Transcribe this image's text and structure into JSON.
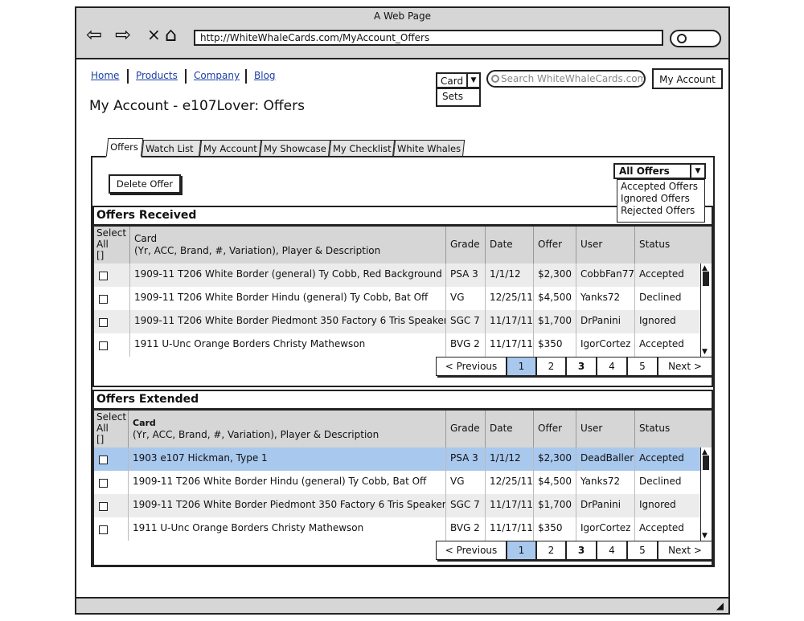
{
  "window": {
    "title": "A Web Page",
    "url": "http://WhiteWhaleCards.com/MyAccount_Offers"
  },
  "nav": {
    "home": "Home",
    "products": "Products",
    "company": "Company",
    "blog": "Blog"
  },
  "search": {
    "category": "Card",
    "option_sets": "Sets",
    "placeholder": "Search WhiteWhaleCards.com",
    "my_account": "My Account"
  },
  "page": {
    "title": "My Account - e107Lover: Offers"
  },
  "tabs": [
    {
      "label": "Offers"
    },
    {
      "label": "Watch List"
    },
    {
      "label": "My Account"
    },
    {
      "label": "My Showcase"
    },
    {
      "label": "My Checklist"
    },
    {
      "label": "White Whales"
    }
  ],
  "actions": {
    "delete_offer": "Delete Offer"
  },
  "filter": {
    "selected": "All Offers",
    "options": [
      "Accepted Offers",
      "Ignored Offers",
      "Rejected Offers"
    ]
  },
  "columns": {
    "select": [
      "Select",
      "All",
      "[]"
    ],
    "card": "Card",
    "card_sub": "(Yr, ACC, Brand, #, Variation), Player & Description",
    "grade": "Grade",
    "date": "Date",
    "offer": "Offer",
    "user": "User",
    "status": "Status"
  },
  "offers_received": {
    "title": "Offers Received",
    "rows": [
      {
        "card": "1909-11 T206 White Border (general) Ty Cobb, Red Background",
        "grade": "PSA 3",
        "date": "1/1/12",
        "offer": "$2,300",
        "user": "CobbFan77",
        "status": "Accepted"
      },
      {
        "card": "1909-11 T206 White Border Hindu (general) Ty Cobb, Bat Off",
        "grade": "VG",
        "date": "12/25/11",
        "offer": "$4,500",
        "user": "Yanks72",
        "status": "Declined"
      },
      {
        "card": "1909-11 T206 White Border Piedmont 350 Factory 6 Tris Speaker",
        "grade": "SGC 7",
        "date": "11/17/11",
        "offer": "$1,700",
        "user": "DrPanini",
        "status": "Ignored"
      },
      {
        "card": "1911 U-Unc Orange Borders Christy Mathewson",
        "grade": "BVG 2",
        "date": "11/17/11",
        "offer": "$350",
        "user": "IgorCortez",
        "status": "Accepted"
      }
    ]
  },
  "offers_extended": {
    "title": "Offers Extended",
    "rows": [
      {
        "card": "1903 e107 Hickman, Type 1",
        "grade": "PSA 3",
        "date": "1/1/12",
        "offer": "$2,300",
        "user": "DeadBaller",
        "status": "Accepted"
      },
      {
        "card": "1909-11 T206 White Border Hindu (general) Ty Cobb, Bat Off",
        "grade": "VG",
        "date": "12/25/11",
        "offer": "$4,500",
        "user": "Yanks72",
        "status": "Declined"
      },
      {
        "card": "1909-11 T206 White Border Piedmont 350 Factory 6 Tris Speaker",
        "grade": "SGC 7",
        "date": "11/17/11",
        "offer": "$1,700",
        "user": "DrPanini",
        "status": "Ignored"
      },
      {
        "card": "1911 U-Unc Orange Borders Christy Mathewson",
        "grade": "BVG 2",
        "date": "11/17/11",
        "offer": "$350",
        "user": "IgorCortez",
        "status": "Accepted"
      }
    ]
  },
  "pager": {
    "prev": "< Previous",
    "pages": [
      "1",
      "2",
      "3",
      "4",
      "5"
    ],
    "next": "Next >"
  },
  "colors": {
    "selection": "#a9c8ee",
    "header": "#d6d6d6",
    "chrome": "#d6d6d6",
    "link": "#1a3fa6"
  }
}
